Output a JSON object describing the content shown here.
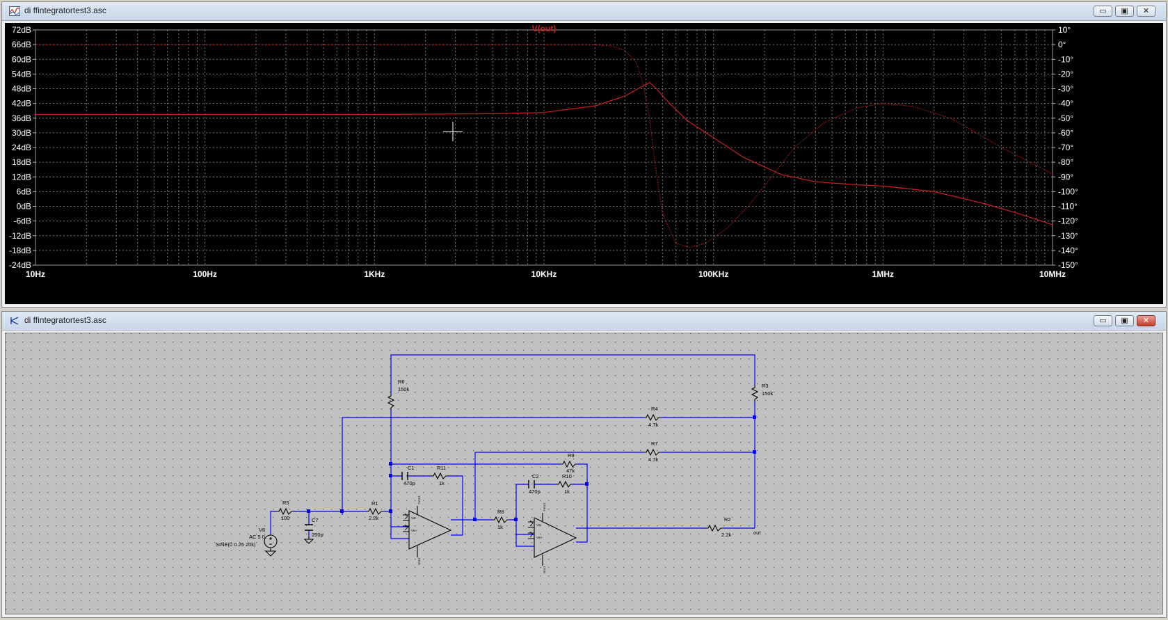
{
  "plot_window": {
    "title": "di ffintegratortest3.asc",
    "buttons": {
      "minimize": "▭",
      "maximize": "▣",
      "close": "✕"
    },
    "trace_label": "V(out)",
    "trace_color": "#cc2020",
    "left_axis_ticks": [
      "72dB",
      "66dB",
      "60dB",
      "54dB",
      "48dB",
      "42dB",
      "36dB",
      "30dB",
      "24dB",
      "18dB",
      "12dB",
      "6dB",
      "0dB",
      "-6dB",
      "-12dB",
      "-18dB",
      "-24dB"
    ],
    "right_axis_ticks": [
      "10°",
      "0°",
      "-10°",
      "-20°",
      "-30°",
      "-40°",
      "-50°",
      "-60°",
      "-70°",
      "-80°",
      "-90°",
      "-100°",
      "-110°",
      "-120°",
      "-130°",
      "-140°",
      "-150°"
    ],
    "x_axis_ticks": [
      "10Hz",
      "100Hz",
      "1KHz",
      "10KHz",
      "100KHz",
      "1MHz",
      "10MHz"
    ]
  },
  "chart_data": {
    "type": "line",
    "title": "V(out)",
    "x_scale": "log",
    "xlim": [
      "10Hz",
      "10MHz"
    ],
    "ylim_left_db": [
      -24,
      72
    ],
    "ylim_right_deg": [
      -150,
      10
    ],
    "grid": true,
    "series": [
      {
        "axis": "left",
        "style": "solid",
        "points": [
          [
            10,
            37.5
          ],
          [
            1000,
            37.5
          ],
          [
            5000,
            37.8
          ],
          [
            10000,
            38.3
          ],
          [
            20000,
            41
          ],
          [
            30000,
            45
          ],
          [
            38000,
            49
          ],
          [
            42000,
            50.5
          ],
          [
            46000,
            48
          ],
          [
            55000,
            42
          ],
          [
            70000,
            35
          ],
          [
            100000,
            28
          ],
          [
            150000,
            20
          ],
          [
            250000,
            13
          ],
          [
            400000,
            10
          ],
          [
            700000,
            8.8
          ],
          [
            1000000,
            8.3
          ],
          [
            2000000,
            6
          ],
          [
            4000000,
            1
          ],
          [
            6000000,
            -2.5
          ],
          [
            10000000,
            -7.5
          ]
        ]
      },
      {
        "axis": "right",
        "style": "dotted",
        "points": [
          [
            10,
            0
          ],
          [
            10000,
            0
          ],
          [
            20000,
            0
          ],
          [
            25000,
            -1
          ],
          [
            30000,
            -4
          ],
          [
            35000,
            -12
          ],
          [
            38000,
            -25
          ],
          [
            42000,
            -50
          ],
          [
            45000,
            -80
          ],
          [
            50000,
            -115
          ],
          [
            60000,
            -135
          ],
          [
            72000,
            -138
          ],
          [
            90000,
            -135
          ],
          [
            120000,
            -125
          ],
          [
            160000,
            -110
          ],
          [
            220000,
            -90
          ],
          [
            300000,
            -70
          ],
          [
            450000,
            -53
          ],
          [
            700000,
            -43
          ],
          [
            1000000,
            -40
          ],
          [
            1500000,
            -42
          ],
          [
            2500000,
            -50
          ],
          [
            5000000,
            -70
          ],
          [
            10000000,
            -88
          ]
        ]
      }
    ]
  },
  "schematic_window": {
    "title": "di ffintegratortest3.asc",
    "buttons": {
      "minimize": "▭",
      "maximize": "▣",
      "close": "✕"
    },
    "components": {
      "R6": {
        "name": "R6",
        "value": "150k"
      },
      "R3": {
        "name": "R3",
        "value": "150k"
      },
      "R4": {
        "name": "R4",
        "value": "4.7k"
      },
      "R7": {
        "name": "R7",
        "value": "4.7k"
      },
      "R9": {
        "name": "R9",
        "value": "47k"
      },
      "R11": {
        "name": "R11",
        "value": "1k"
      },
      "R10": {
        "name": "R10",
        "value": "1k"
      },
      "C1": {
        "name": "C1",
        "value": "470p"
      },
      "C2": {
        "name": "C2",
        "value": "470p"
      },
      "R5": {
        "name": "R5",
        "value": "100"
      },
      "C7": {
        "name": "C7",
        "value": "250p"
      },
      "R1": {
        "name": "R1",
        "value": "2.2k"
      },
      "R8": {
        "name": "R8",
        "value": "1k"
      },
      "R2": {
        "name": "R2",
        "value": "2.2k"
      },
      "V6": {
        "name": "V6",
        "ac": "AC 5 0",
        "sine": "SINE(0 0.25 20k)"
      },
      "out_label": "out",
      "opamp_pins": {
        "vcc1": "+Vcc1",
        "vee1": "-Vcc1",
        "vin_n": "Vin-",
        "vin_p": "Vin+"
      }
    }
  }
}
